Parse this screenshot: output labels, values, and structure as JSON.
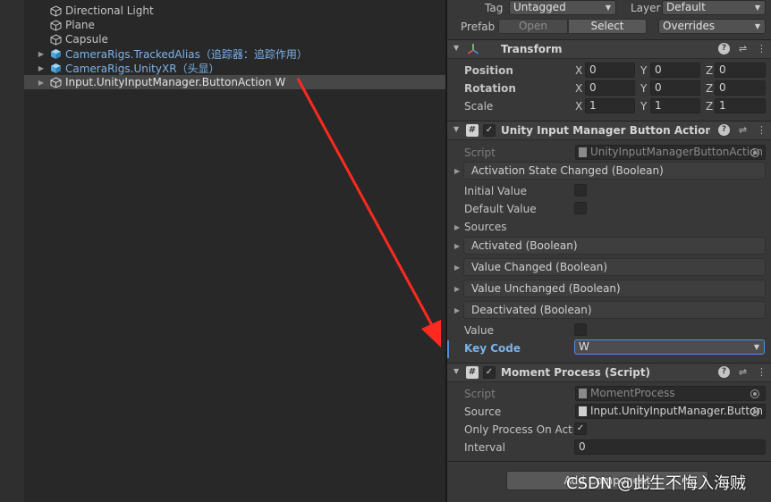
{
  "hierarchy": {
    "items": [
      {
        "label": "Directional Light",
        "icon": "gameobject-icon",
        "blue": false,
        "fold": false
      },
      {
        "label": "Plane",
        "icon": "gameobject-icon",
        "blue": false,
        "fold": false
      },
      {
        "label": "Capsule",
        "icon": "gameobject-icon",
        "blue": false,
        "fold": false
      },
      {
        "label": "CameraRigs.TrackedAlias（追踪器：追踪作用）",
        "icon": "prefab-icon",
        "blue": true,
        "fold": true
      },
      {
        "label": "CameraRigs.UnityXR（头显）",
        "icon": "prefab-icon",
        "blue": true,
        "fold": true
      },
      {
        "label": "Input.UnityInputManager.ButtonAction W",
        "icon": "gameobject-icon",
        "blue": false,
        "fold": true,
        "selected": true
      }
    ]
  },
  "inspector": {
    "tag_label": "Tag",
    "tag_value": "Untagged",
    "layer_label": "Layer",
    "layer_value": "Default",
    "prefab_label": "Prefab",
    "prefab_open": "Open",
    "prefab_select": "Select",
    "prefab_overrides": "Overrides",
    "transform": {
      "title": "Transform",
      "rows": [
        {
          "label": "Position",
          "x": "0",
          "y": "0",
          "z": "0"
        },
        {
          "label": "Rotation",
          "x": "0",
          "y": "0",
          "z": "0"
        },
        {
          "label": "Scale",
          "x": "1",
          "y": "1",
          "z": "1"
        }
      ],
      "axes": [
        "X",
        "Y",
        "Z"
      ]
    },
    "button_action": {
      "title": "Unity Input Manager Button Action (Script)",
      "script_label": "Script",
      "script_value": "UnityInputManagerButtonAction",
      "activation_event": "Activation State Changed (Boolean)",
      "initial_value_label": "Initial Value",
      "default_value_label": "Default Value",
      "sources_label": "Sources",
      "activated_event": "Activated (Boolean)",
      "value_changed_event": "Value Changed (Boolean)",
      "value_unchanged_event": "Value Unchanged (Boolean)",
      "deactivated_event": "Deactivated (Boolean)",
      "value_label": "Value",
      "key_code_label": "Key Code",
      "key_code_value": "W"
    },
    "moment_process": {
      "title": "Moment Process (Script)",
      "script_label": "Script",
      "script_value": "MomentProcess",
      "source_label": "Source",
      "source_value": "Input.UnityInputManager.Button",
      "only_process_label": "Only Process On Active",
      "only_process_checked": "✓",
      "interval_label": "Interval",
      "interval_value": "0"
    },
    "add_component": "Add Component"
  },
  "watermark": "CSDN @此生不悔入海贼",
  "colors": {
    "panel": "#383838",
    "hierarchy_bg": "#282828",
    "prefab_blue": "#7bb3ea",
    "annotation_arrow": "#ff2a1f"
  }
}
